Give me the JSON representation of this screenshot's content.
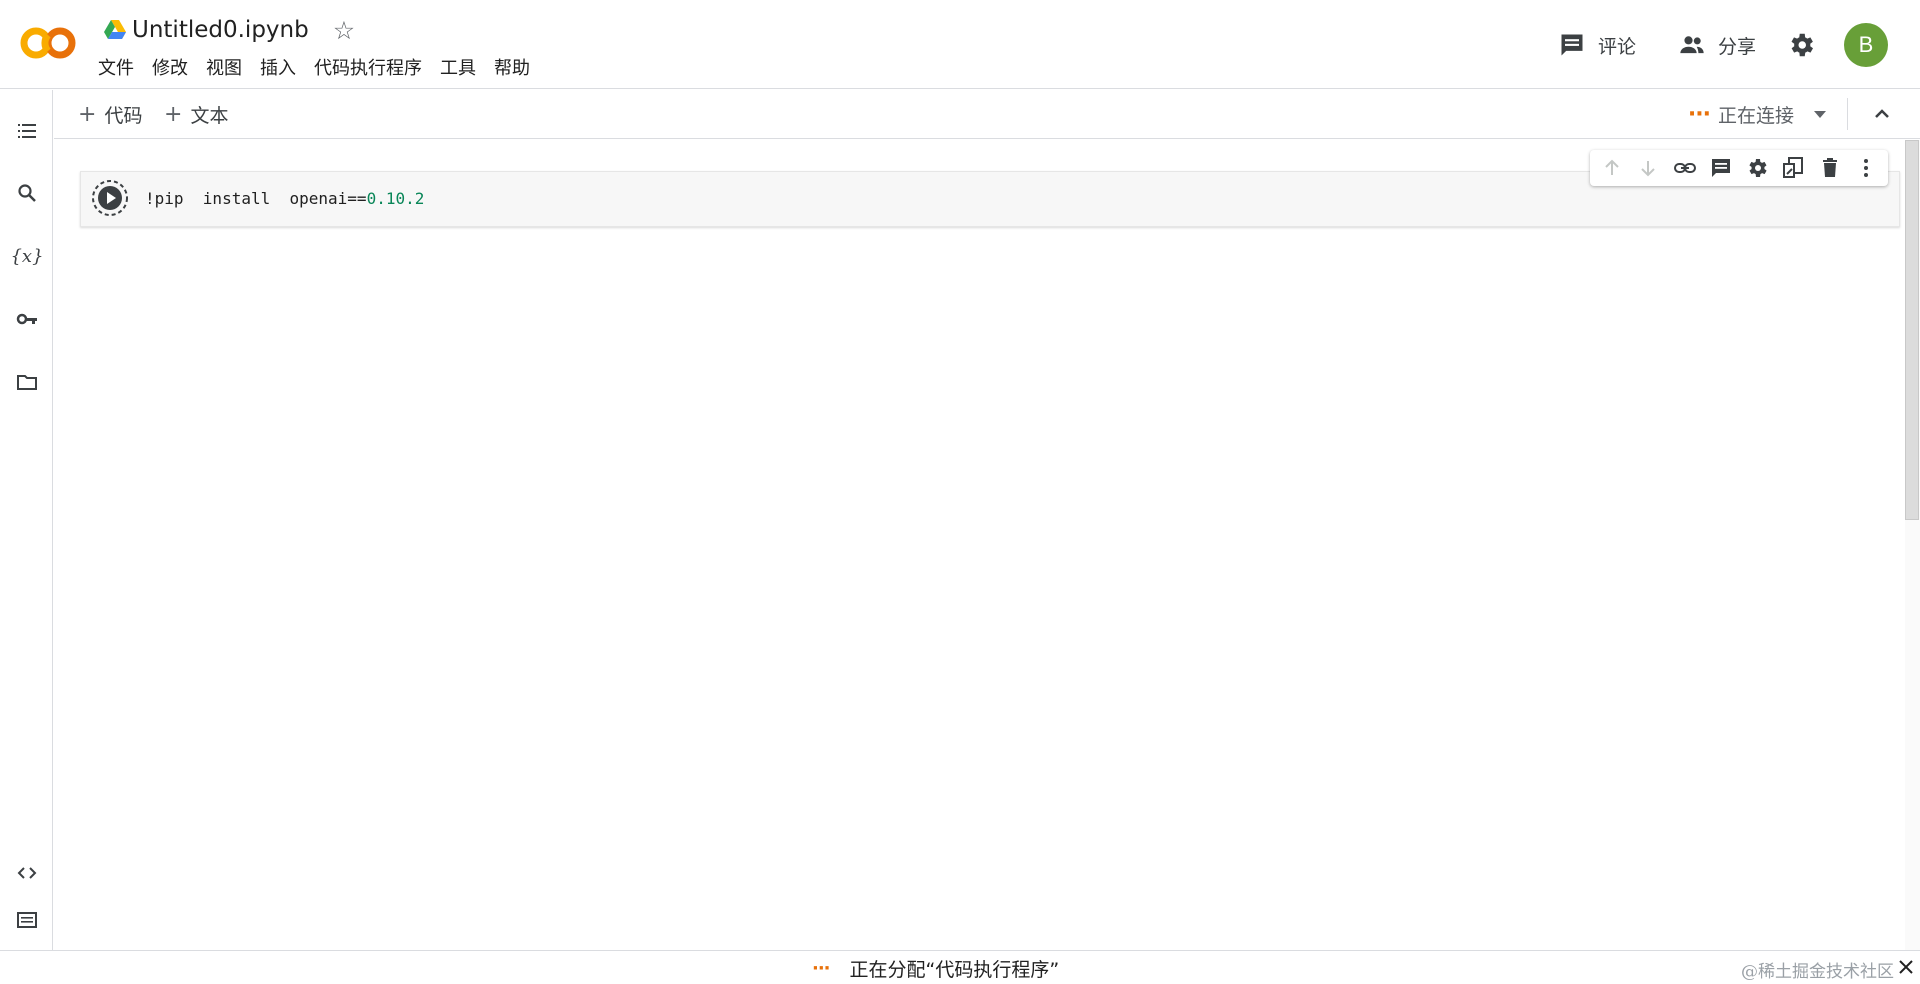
{
  "app": {
    "logo_text": "CO",
    "document_title": "Untitled0.ipynb",
    "star_glyph": "☆"
  },
  "menu": [
    "文件",
    "修改",
    "视图",
    "插入",
    "代码执行程序",
    "工具",
    "帮助"
  ],
  "header_actions": {
    "comment_label": "评论",
    "share_label": "分享",
    "avatar_initial": "B",
    "avatar_color": "#689f38"
  },
  "toolbar": {
    "add_code_label": "代码",
    "add_text_label": "文本",
    "plus_glyph": "+",
    "connection_dots": "···",
    "connection_status": "正在连接"
  },
  "cell": {
    "code_prefix": "!pip  install  openai==",
    "code_version": "0.10.2"
  },
  "statusbar": {
    "dots": "···",
    "message": "正在分配“代码执行程序”",
    "watermark": "@稀土掘金技术社区"
  },
  "colors": {
    "accent_orange": "#e8710a",
    "logo_orange": "#f9ab00",
    "code_number": "#098658"
  }
}
